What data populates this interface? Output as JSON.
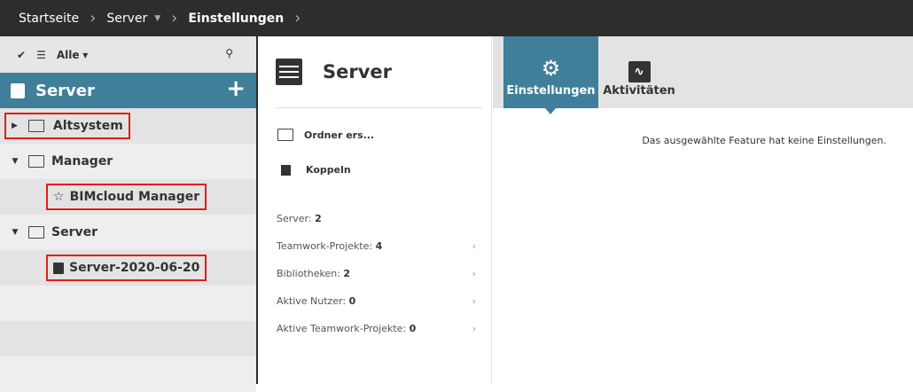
{
  "breadcrumb": {
    "items": [
      "Startseite",
      "Server",
      "Einstellungen"
    ]
  },
  "toolbar": {
    "filter": "Alle"
  },
  "tree": {
    "header": "Server",
    "items": [
      {
        "label": "Altsystem"
      },
      {
        "label": "Manager"
      },
      {
        "label": "BIMcloud Manager"
      },
      {
        "label": "Server"
      },
      {
        "label": "Server-2020-06-20"
      }
    ]
  },
  "detail": {
    "title": "Server",
    "actions": [
      "Ordner ers...",
      "Koppeln"
    ],
    "stats": [
      {
        "label": "Server: ",
        "value": "2"
      },
      {
        "label": "Teamwork-Projekte: ",
        "value": "4"
      },
      {
        "label": "Bibliotheken: ",
        "value": "2"
      },
      {
        "label": "Aktive Nutzer: ",
        "value": "0"
      },
      {
        "label": "Aktive Teamwork-Projekte: ",
        "value": "0"
      }
    ]
  },
  "tabs": [
    "Einstellungen",
    "Aktivitäten"
  ],
  "message": "Das ausgewählte Feature hat keine Einstellungen.",
  "colors": {
    "accent": "#3f7f9a",
    "topbar": "#2d2d2d",
    "highlight": "#e31b1b"
  }
}
